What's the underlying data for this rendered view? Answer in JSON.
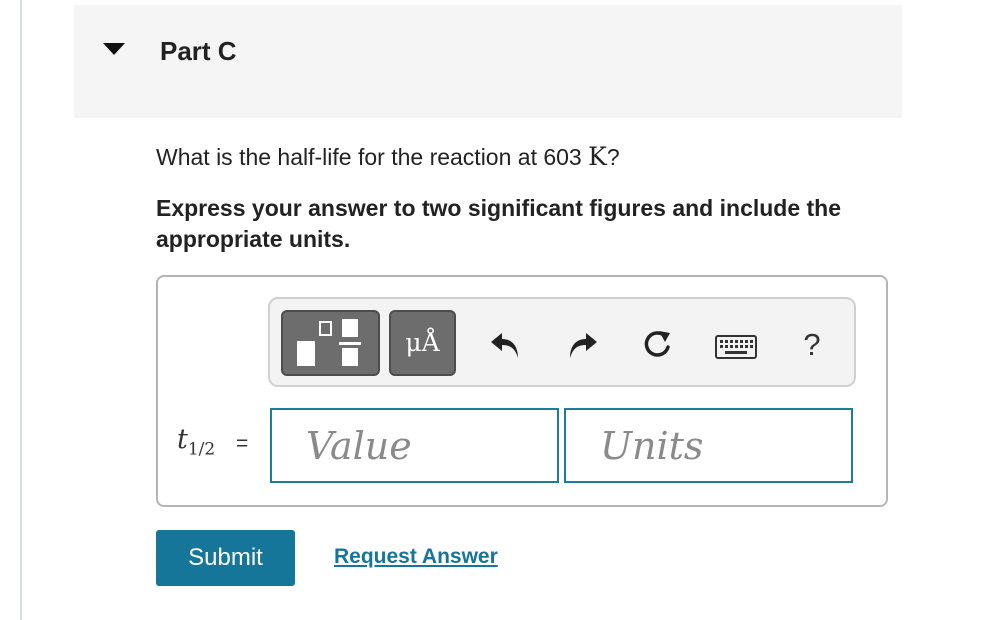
{
  "part": {
    "title": "Part C",
    "toggle_icon": "caret-down-icon"
  },
  "question": {
    "text_before": "What is the half-life for the reaction at 603 ",
    "unit": "K",
    "text_after": "?"
  },
  "instruction": "Express your answer to two significant figures and include the appropriate units.",
  "toolbar": {
    "templates_icon": "templates-icon",
    "units_label": "μÅ",
    "undo_icon": "undo-icon",
    "redo_icon": "redo-icon",
    "reset_icon": "reset-icon",
    "keyboard_icon": "keyboard-icon",
    "help_label": "?"
  },
  "answer": {
    "variable": "t",
    "variable_sub": "1/2",
    "equals": "=",
    "value_placeholder": "Value",
    "value": "",
    "units_placeholder": "Units",
    "units": ""
  },
  "actions": {
    "submit_label": "Submit",
    "request_label": "Request Answer"
  },
  "colors": {
    "accent": "#16769a",
    "header_bg": "#f5f5f5",
    "toolbar_button": "#6d6d6d"
  }
}
